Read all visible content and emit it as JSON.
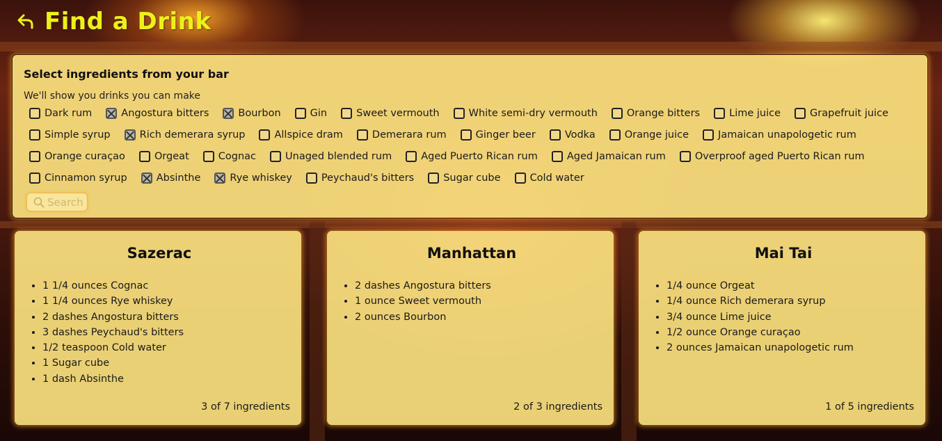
{
  "header": {
    "title": "Find a Drink",
    "back_icon": "back-arrow-icon"
  },
  "panel": {
    "heading": "Select ingredients from your bar",
    "subheading": "We'll show you drinks you can make",
    "ingredients": [
      {
        "label": "Dark rum",
        "checked": false
      },
      {
        "label": "Angostura bitters",
        "checked": true
      },
      {
        "label": "Bourbon",
        "checked": true
      },
      {
        "label": "Gin",
        "checked": false
      },
      {
        "label": "Sweet vermouth",
        "checked": false
      },
      {
        "label": "White semi-dry vermouth",
        "checked": false
      },
      {
        "label": "Orange bitters",
        "checked": false
      },
      {
        "label": "Lime juice",
        "checked": false
      },
      {
        "label": "Grapefruit juice",
        "checked": false
      },
      {
        "label": "Simple syrup",
        "checked": false
      },
      {
        "label": "Rich demerara syrup",
        "checked": true
      },
      {
        "label": "Allspice dram",
        "checked": false
      },
      {
        "label": "Demerara rum",
        "checked": false
      },
      {
        "label": "Ginger beer",
        "checked": false
      },
      {
        "label": "Vodka",
        "checked": false
      },
      {
        "label": "Orange juice",
        "checked": false
      },
      {
        "label": "Jamaican unapologetic rum",
        "checked": false
      },
      {
        "label": "Orange curaçao",
        "checked": false
      },
      {
        "label": "Orgeat",
        "checked": false
      },
      {
        "label": "Cognac",
        "checked": false
      },
      {
        "label": "Unaged blended rum",
        "checked": false
      },
      {
        "label": "Aged Puerto Rican rum",
        "checked": false
      },
      {
        "label": "Aged Jamaican rum",
        "checked": false
      },
      {
        "label": "Overproof aged Puerto Rican rum",
        "checked": false
      },
      {
        "label": "Cinnamon syrup",
        "checked": false
      },
      {
        "label": "Absinthe",
        "checked": true
      },
      {
        "label": "Rye whiskey",
        "checked": true
      },
      {
        "label": "Peychaud's bitters",
        "checked": false
      },
      {
        "label": "Sugar cube",
        "checked": false
      },
      {
        "label": "Cold water",
        "checked": false
      }
    ],
    "search": {
      "label": "Search",
      "icon": "search-icon"
    }
  },
  "drinks": [
    {
      "name": "Sazerac",
      "ingredients": [
        "1 1/4 ounces Cognac",
        "1 1/4 ounces Rye whiskey",
        "2 dashes Angostura bitters",
        "3 dashes Peychaud's bitters",
        "1/2 teaspoon Cold water",
        "1 Sugar cube",
        "1 dash Absinthe"
      ],
      "count": "3 of 7 ingredients"
    },
    {
      "name": "Manhattan",
      "ingredients": [
        "2 dashes Angostura bitters",
        "1 ounce Sweet vermouth",
        "2 ounces Bourbon"
      ],
      "count": "2 of 3 ingredients"
    },
    {
      "name": "Mai Tai",
      "ingredients": [
        "1/4 ounce Orgeat",
        "1/4 ounce Rich demerara syrup",
        "3/4 ounce Lime juice",
        "1/2 ounce Orange curaçao",
        "2 ounces Jamaican unapologetic rum"
      ],
      "count": "1 of 5 ingredients"
    }
  ],
  "colors": {
    "title": "#ecf11a",
    "panel_bg": "#ffe582",
    "glow": "#ffaa28"
  }
}
